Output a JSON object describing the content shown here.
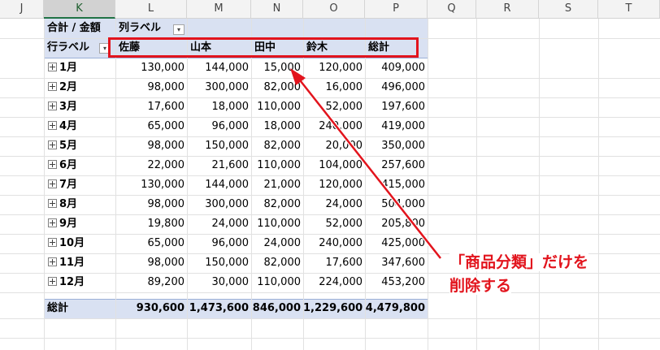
{
  "columns": [
    {
      "letter": "J"
    },
    {
      "letter": "K",
      "selected": true
    },
    {
      "letter": "L"
    },
    {
      "letter": "M"
    },
    {
      "letter": "N"
    },
    {
      "letter": "O"
    },
    {
      "letter": "P"
    },
    {
      "letter": "Q"
    },
    {
      "letter": "R"
    },
    {
      "letter": "S"
    },
    {
      "letter": "T"
    }
  ],
  "pivot": {
    "corner_label": "合計 / 金額",
    "col_label": "列ラベル",
    "row_label": "行ラベル",
    "headers": [
      "佐藤",
      "山本",
      "田中",
      "鈴木",
      "総計"
    ],
    "rows": [
      {
        "label": "1月",
        "values": [
          "130,000",
          "144,000",
          "15,000",
          "120,000",
          "409,000"
        ]
      },
      {
        "label": "2月",
        "values": [
          "98,000",
          "300,000",
          "82,000",
          "16,000",
          "496,000"
        ]
      },
      {
        "label": "3月",
        "values": [
          "17,600",
          "18,000",
          "110,000",
          "52,000",
          "197,600"
        ]
      },
      {
        "label": "4月",
        "values": [
          "65,000",
          "96,000",
          "18,000",
          "240,000",
          "419,000"
        ]
      },
      {
        "label": "5月",
        "values": [
          "98,000",
          "150,000",
          "82,000",
          "20,000",
          "350,000"
        ]
      },
      {
        "label": "6月",
        "values": [
          "22,000",
          "21,600",
          "110,000",
          "104,000",
          "257,600"
        ]
      },
      {
        "label": "7月",
        "values": [
          "130,000",
          "144,000",
          "21,000",
          "120,000",
          "415,000"
        ]
      },
      {
        "label": "8月",
        "values": [
          "98,000",
          "300,000",
          "82,000",
          "24,000",
          "504,000"
        ]
      },
      {
        "label": "9月",
        "values": [
          "19,800",
          "24,000",
          "110,000",
          "52,000",
          "205,800"
        ]
      },
      {
        "label": "10月",
        "values": [
          "65,000",
          "96,000",
          "24,000",
          "240,000",
          "425,000"
        ]
      },
      {
        "label": "11月",
        "values": [
          "98,000",
          "150,000",
          "82,000",
          "17,600",
          "347,600"
        ]
      },
      {
        "label": "12月",
        "values": [
          "89,200",
          "30,000",
          "110,000",
          "224,000",
          "453,200"
        ]
      }
    ],
    "total": {
      "label": "総計",
      "values": [
        "930,600",
        "1,473,600",
        "846,000",
        "1,229,600",
        "4,479,800"
      ]
    }
  },
  "annotation": {
    "line1": "「商品分類」だけを",
    "line2": "削除する",
    "color": "#e2141d"
  },
  "colors": {
    "pivot_band": "#d9e1f2",
    "highlight": "#e2141d",
    "selected_col_accent": "#217346"
  }
}
